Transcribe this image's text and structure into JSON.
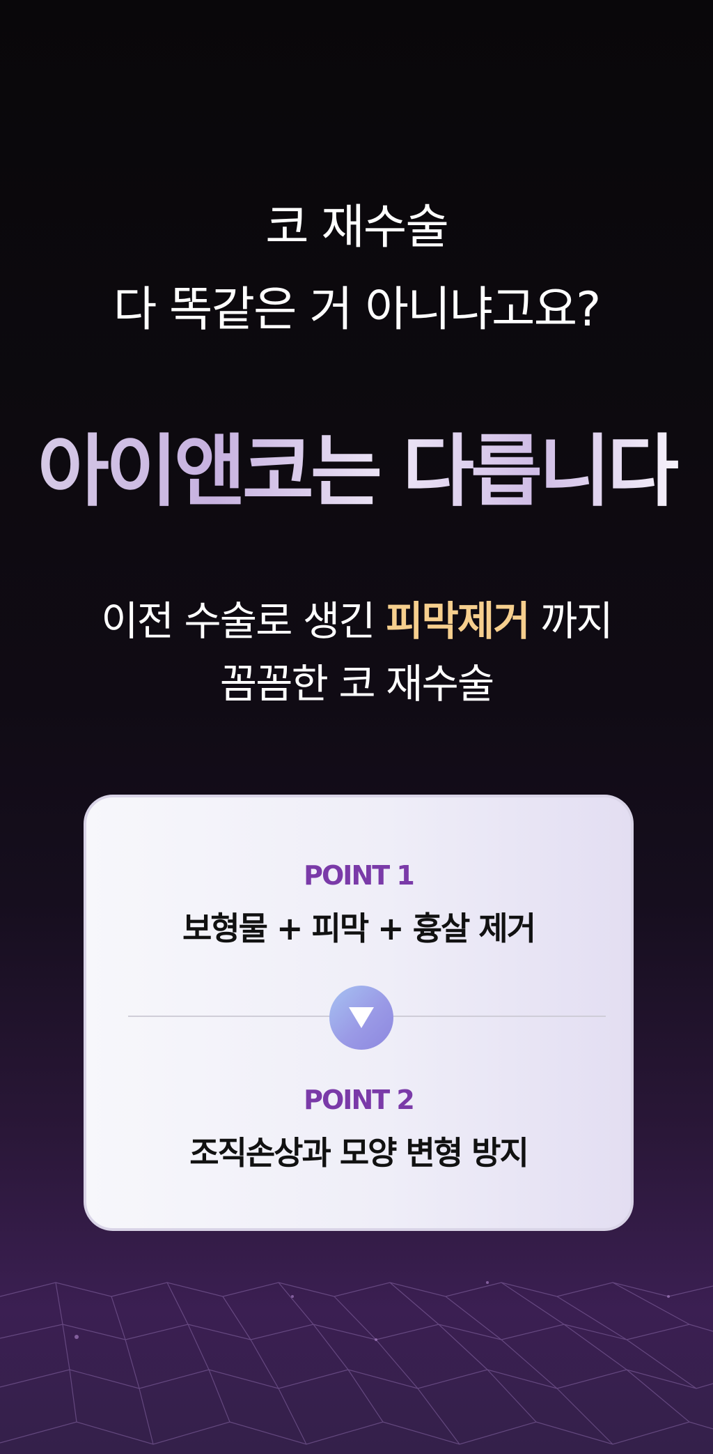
{
  "intro": {
    "line1": "코 재수술",
    "line2": "다 똑같은 거 아니냐고요?"
  },
  "headline": "아이앤코는 다릅니다",
  "sub": {
    "line1_pre": "이전 수술로 생긴 ",
    "line1_highlight": "피막제거",
    "line1_post": " 까지",
    "line2": "꼼꼼한 코 재수술"
  },
  "card": {
    "point1_label": "POINT 1",
    "point1_text": "보형물 + 피막 + 흉살 제거",
    "arrow_icon": "triangle-down-icon",
    "point2_label": "POINT 2",
    "point2_text": "조직손상과 모양 변형 방지"
  },
  "colors": {
    "highlight": "#f6cf8e",
    "point_label": "#7a3aa8",
    "card_bg": "#f1f0f8"
  }
}
